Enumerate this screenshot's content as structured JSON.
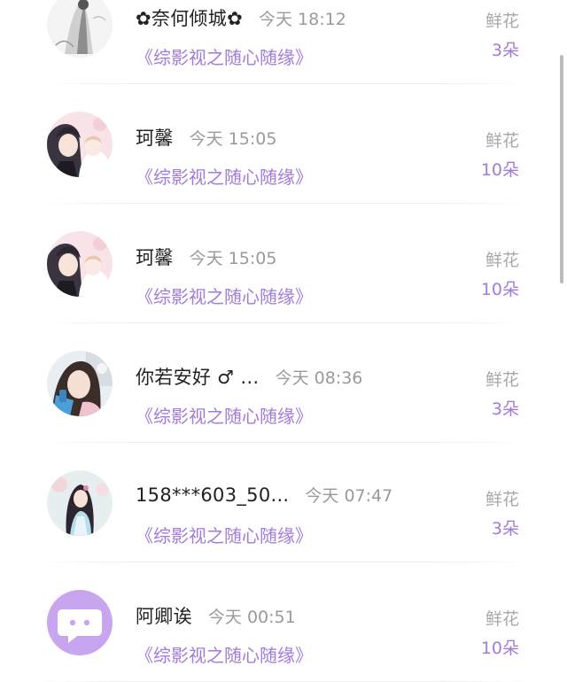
{
  "book_title": "《综影视之随心随缘》",
  "gift_label": "鲜花",
  "colors": {
    "accent": "#a37bdb",
    "name": "#222222",
    "muted": "#9a9a9a"
  },
  "entries": [
    {
      "name": "✿奈何倾城✿",
      "time": "今天 18:12",
      "book": "《综影视之随心随缘》",
      "gift_label": "鲜花",
      "gift_count": "3朵",
      "avatar": "ink-painting-avatar"
    },
    {
      "name": "珂馨",
      "time": "今天 15:05",
      "book": "《综影视之随心随缘》",
      "gift_label": "鲜花",
      "gift_count": "10朵",
      "avatar": "anime-couple-avatar"
    },
    {
      "name": "珂馨",
      "time": "今天 15:05",
      "book": "《综影视之随心随缘》",
      "gift_label": "鲜花",
      "gift_count": "10朵",
      "avatar": "anime-couple-avatar"
    },
    {
      "name": "你若安好 ♂ …",
      "time": "今天 08:36",
      "book": "《综影视之随心随缘》",
      "gift_label": "鲜花",
      "gift_count": "3朵",
      "avatar": "photo-avatar"
    },
    {
      "name": "158***603_50...",
      "time": "今天 07:47",
      "book": "《综影视之随心随缘》",
      "gift_label": "鲜花",
      "gift_count": "3朵",
      "avatar": "hanfu-girl-avatar"
    },
    {
      "name": "阿卿诶",
      "time": "今天 00:51",
      "book": "《综影视之随心随缘》",
      "gift_label": "鲜花",
      "gift_count": "10朵",
      "avatar": "default-chat-avatar"
    }
  ]
}
